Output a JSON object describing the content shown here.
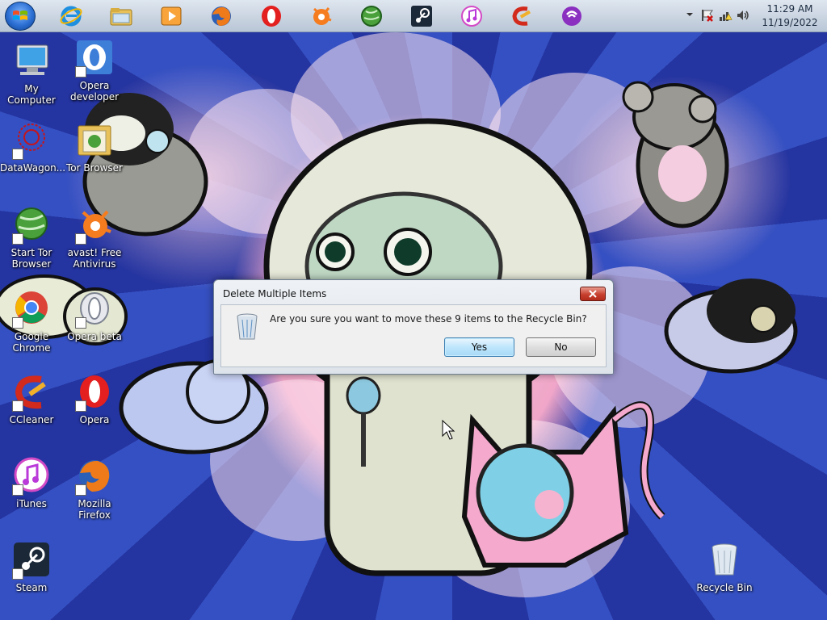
{
  "taskbar": {
    "start_label": "Start",
    "pinned": [
      {
        "name": "internet-explorer",
        "icon": "internet-explorer-icon"
      },
      {
        "name": "windows-explorer",
        "icon": "folder-icon"
      },
      {
        "name": "media-player",
        "icon": "media-player-icon"
      },
      {
        "name": "firefox",
        "icon": "firefox-icon"
      },
      {
        "name": "opera",
        "icon": "opera-icon"
      },
      {
        "name": "avast",
        "icon": "avast-icon"
      },
      {
        "name": "tor",
        "icon": "tor-globe-icon"
      },
      {
        "name": "steam",
        "icon": "steam-icon"
      },
      {
        "name": "itunes",
        "icon": "itunes-icon"
      },
      {
        "name": "ccleaner",
        "icon": "ccleaner-icon"
      },
      {
        "name": "utorrent",
        "icon": "utorrent-icon"
      }
    ],
    "clock": {
      "time": "11:29 AM",
      "date": "11/19/2022"
    }
  },
  "desktop": {
    "icons": [
      {
        "label": "My Computer",
        "icon": "computer-icon",
        "shortcut": false
      },
      {
        "label": "Opera developer",
        "icon": "opera-developer-icon",
        "shortcut": true
      },
      {
        "label": "DataWagon...",
        "icon": "datawagon-icon",
        "shortcut": true
      },
      {
        "label": "Tor Browser",
        "icon": "folder-icon",
        "shortcut": false
      },
      {
        "label": "Start Tor Browser",
        "icon": "tor-globe-icon",
        "shortcut": true
      },
      {
        "label": "avast! Free Antivirus",
        "icon": "avast-icon",
        "shortcut": true
      },
      {
        "label": "Google Chrome",
        "icon": "chrome-icon",
        "shortcut": true
      },
      {
        "label": "Opera beta",
        "icon": "opera-beta-icon",
        "shortcut": true
      },
      {
        "label": "CCleaner",
        "icon": "ccleaner-icon",
        "shortcut": true
      },
      {
        "label": "Opera",
        "icon": "opera-icon",
        "shortcut": true
      },
      {
        "label": "iTunes",
        "icon": "itunes-icon",
        "shortcut": true
      },
      {
        "label": "Mozilla Firefox",
        "icon": "firefox-icon",
        "shortcut": true
      },
      {
        "label": "Steam",
        "icon": "steam-icon",
        "shortcut": true
      },
      {
        "label": "Recycle Bin",
        "icon": "recycle-bin-icon",
        "shortcut": false
      }
    ]
  },
  "dialog": {
    "title": "Delete Multiple Items",
    "message": "Are you sure you want to move these 9 items to the Recycle Bin?",
    "yes_label": "Yes",
    "no_label": "No",
    "icon": "recycle-bin-icon"
  },
  "colors": {
    "wallpaper_blue": "#2a3ea8",
    "wallpaper_pink": "#f0a6c8",
    "close_red": "#c7402f",
    "default_button": "#bee6fd"
  }
}
